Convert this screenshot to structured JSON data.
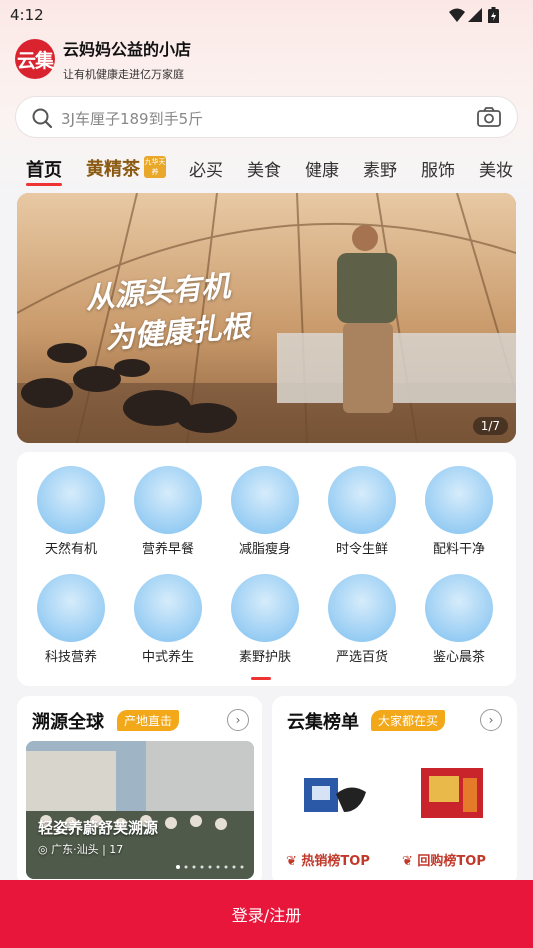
{
  "status": {
    "time": "4:12"
  },
  "shop": {
    "logo": "云集",
    "name": "云妈妈公益的小店",
    "desc": "让有机健康走进亿万家庭"
  },
  "search": {
    "placeholder": "3J车厘子189到手5斤"
  },
  "tabs": [
    "首页",
    "黄精茶",
    "必买",
    "美食",
    "健康",
    "素野",
    "服饰",
    "美妆"
  ],
  "tab_badge": "九华天养",
  "banner": {
    "line1": "从源头有机",
    "line2": "为健康扎根",
    "pager": "1/7"
  },
  "categories": [
    "天然有机",
    "营养早餐",
    "减脂瘦身",
    "时令生鲜",
    "配料干净",
    "科技营养",
    "中式养生",
    "素野护肤",
    "严选百货",
    "鉴心晨茶"
  ],
  "origin": {
    "title": "溯源全球",
    "tag": "产地直击",
    "photo_title": "轻姿养蔚舒芙溯源",
    "location": "广东·汕头 | 17"
  },
  "ranking": {
    "title": "云集榜单",
    "tag": "大家都在买",
    "hot": "热销榜TOP",
    "repeat": "回购榜TOP"
  },
  "login_label": "登录/注册",
  "colors": {
    "brand": "#d9232f",
    "login": "#e8163b",
    "tag": "#f3a81a"
  }
}
